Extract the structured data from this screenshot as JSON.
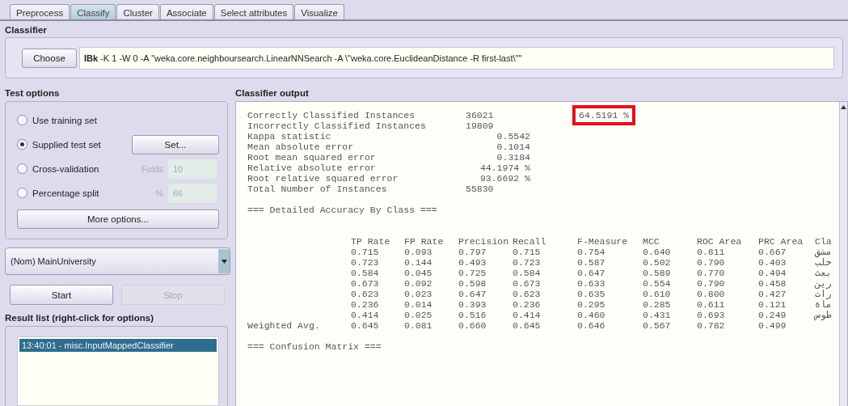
{
  "tabs": [
    {
      "label": "Preprocess",
      "selected": false
    },
    {
      "label": "Classify",
      "selected": true
    },
    {
      "label": "Cluster",
      "selected": false
    },
    {
      "label": "Associate",
      "selected": false
    },
    {
      "label": "Select attributes",
      "selected": false
    },
    {
      "label": "Visualize",
      "selected": false
    }
  ],
  "classifier": {
    "title": "Classifier",
    "button": "Choose",
    "name": "IBk",
    "options": "-K 1 -W 0 -A \"weka.core.neighboursearch.LinearNNSearch -A \\\"weka.core.EuclideanDistance -R first-last\\\"\""
  },
  "test_options": {
    "title": "Test options",
    "options": [
      {
        "label": "Use training set",
        "selected": false,
        "kind": "plain"
      },
      {
        "label": "Supplied test set",
        "selected": true,
        "kind": "button",
        "button": "Set..."
      },
      {
        "label": "Cross-validation",
        "selected": false,
        "kind": "field",
        "caption": "Folds",
        "value": "10",
        "disabled": true
      },
      {
        "label": "Percentage split",
        "selected": false,
        "kind": "field",
        "caption": "%",
        "value": "66",
        "disabled": true
      }
    ],
    "more_button": "More options..."
  },
  "class_select": {
    "value": "(Nom) MainUniversity"
  },
  "run_buttons": [
    {
      "label": "Start",
      "disabled": false
    },
    {
      "label": "Stop",
      "disabled": true
    }
  ],
  "result_list": {
    "title": "Result list (right-click for options)",
    "items": [
      {
        "label": "13:40:01 - misc.InputMappedClassifier",
        "selected": true
      }
    ]
  },
  "output": {
    "title": "Classifier output",
    "summary": [
      {
        "label": "Correctly Classified Instances",
        "value": "36021",
        "kind": "count",
        "percent": "64.5191 %",
        "highlighted": true
      },
      {
        "label": "Incorrectly Classified Instances",
        "value": "19809",
        "kind": "count"
      },
      {
        "label": "Kappa statistic",
        "value": "0.5542",
        "kind": "decimal"
      },
      {
        "label": "Mean absolute error",
        "value": "0.1014",
        "kind": "decimal"
      },
      {
        "label": "Root mean squared error",
        "value": "0.3184",
        "kind": "decimal"
      },
      {
        "label": "Relative absolute error",
        "value": "44.1974 %",
        "kind": "decimal"
      },
      {
        "label": "Root relative squared error",
        "value": "93.6692 %",
        "kind": "decimal"
      },
      {
        "label": "Total Number of Instances",
        "value": "55830",
        "kind": "count"
      }
    ],
    "section_1": "=== Detailed Accuracy By Class ===",
    "accuracy": {
      "columns": [
        "TP Rate",
        "FP Rate",
        "Precision",
        "Recall",
        "F-Measure",
        "MCC",
        "ROC Area",
        "PRC Area",
        "Cla"
      ],
      "rows": [
        {
          "cells": [
            "0.715",
            "0.093",
            "0.797",
            "0.715",
            "0.754",
            "0.640",
            "0.811",
            "0.667",
            "مشق"
          ]
        },
        {
          "cells": [
            "0.723",
            "0.144",
            "0.493",
            "0.723",
            "0.587",
            "0.502",
            "0.790",
            "0.403",
            "حلب"
          ]
        },
        {
          "cells": [
            "0.584",
            "0.045",
            "0.725",
            "0.584",
            "0.647",
            "0.589",
            "0.770",
            "0.494",
            "بعث"
          ]
        },
        {
          "cells": [
            "0.673",
            "0.092",
            "0.598",
            "0.673",
            "0.633",
            "0.554",
            "0.790",
            "0.458",
            "رين"
          ]
        },
        {
          "cells": [
            "0.623",
            "0.023",
            "0.647",
            "0.623",
            "0.635",
            "0.610",
            "0.800",
            "0.427",
            "رات"
          ]
        },
        {
          "cells": [
            "0.236",
            "0.014",
            "0.393",
            "0.236",
            "0.295",
            "0.285",
            "0.611",
            "0.121",
            "ماة"
          ]
        },
        {
          "cells": [
            "0.414",
            "0.025",
            "0.516",
            "0.414",
            "0.460",
            "0.431",
            "0.693",
            "0.249",
            "طوس"
          ]
        },
        {
          "label": "Weighted Avg.",
          "cells": [
            "0.645",
            "0.081",
            "0.660",
            "0.645",
            "0.646",
            "0.567",
            "0.782",
            "0.499"
          ]
        }
      ]
    },
    "section_2": "=== Confusion Matrix ==="
  }
}
